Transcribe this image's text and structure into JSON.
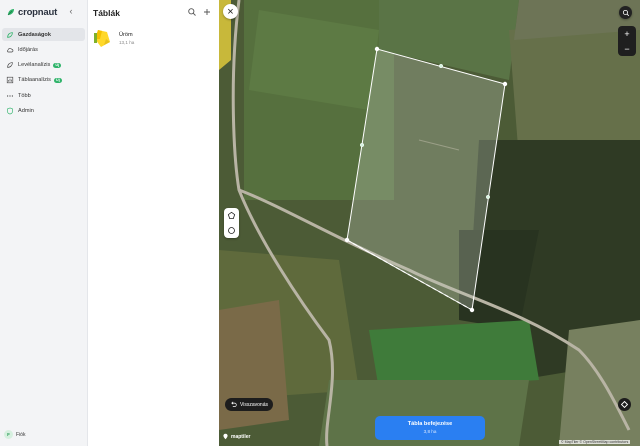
{
  "app": {
    "name": "cropnaut"
  },
  "sidebar": {
    "items": [
      {
        "label": "Gazdaságok",
        "icon": "farm-icon",
        "active": true
      },
      {
        "label": "Időjárás",
        "icon": "cloud-icon"
      },
      {
        "label": "Levélanalízis",
        "icon": "leaf-icon",
        "badge": "Új"
      },
      {
        "label": "Táblaanalízis",
        "icon": "chart-icon",
        "badge": "Új"
      },
      {
        "label": "Több",
        "icon": "more-icon"
      },
      {
        "label": "Admin",
        "icon": "shield-icon"
      }
    ],
    "account": {
      "initial": "F",
      "name": "Fiók"
    }
  },
  "panel": {
    "title": "Táblák",
    "fields": [
      {
        "name": "Üröm",
        "area": "13,1 ha"
      }
    ]
  },
  "map": {
    "undo_label": "Visszavonás",
    "finish_label": "Tábla befejezése",
    "finish_area": "3,8 ha",
    "logo_text": "maptiler",
    "attribution": "© MapTiler © OpenStreetMap contributors"
  },
  "colors": {
    "accent": "#2fb36a",
    "primary": "#2a7ff2"
  }
}
